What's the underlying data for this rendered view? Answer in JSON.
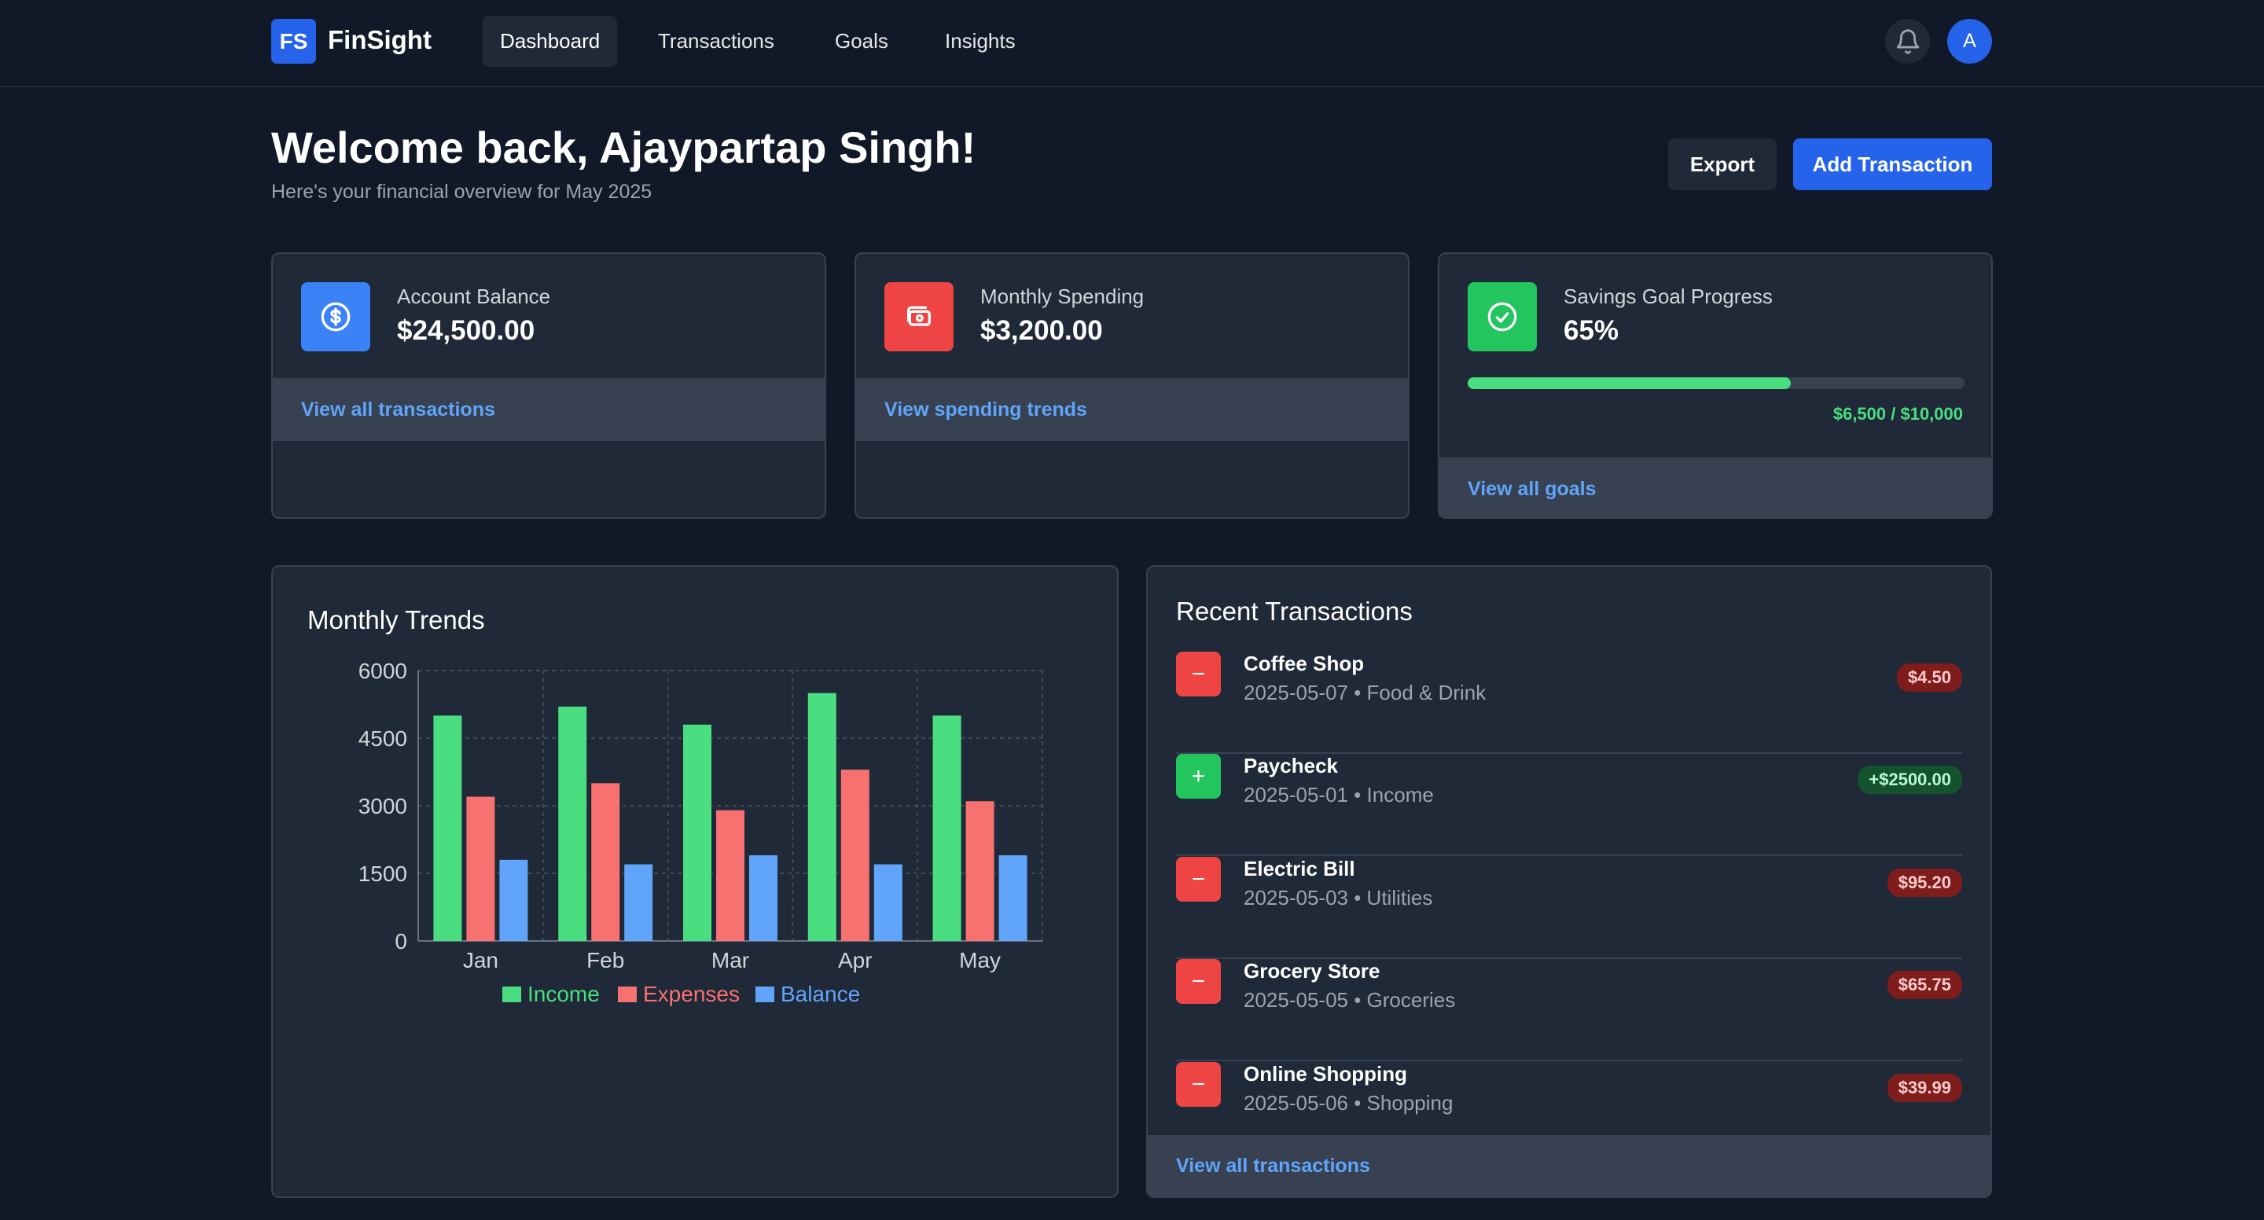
{
  "nav": {
    "logo": "FS",
    "brand": "FinSight",
    "links": [
      "Dashboard",
      "Transactions",
      "Goals",
      "Insights"
    ],
    "active": "Dashboard",
    "avatar_initial": "A"
  },
  "header": {
    "title": "Welcome back, Ajaypartap Singh!",
    "subtitle": "Here's your financial overview for May 2025",
    "export_label": "Export",
    "add_label": "Add Transaction"
  },
  "cards": {
    "balance": {
      "label": "Account Balance",
      "value": "$24,500.00",
      "link": "View all transactions",
      "icon": "dollar-circle-icon",
      "color": "#3b82f6"
    },
    "spending": {
      "label": "Monthly Spending",
      "value": "$3,200.00",
      "link": "View spending trends",
      "icon": "cash-icon",
      "color": "#ef4444"
    },
    "savings": {
      "label": "Savings Goal Progress",
      "value": "65%",
      "progress": 0.65,
      "progress_text": "$6,500 / $10,000",
      "link": "View all goals",
      "icon": "check-circle-icon",
      "color": "#22c55e"
    }
  },
  "trends": {
    "title": "Monthly Trends"
  },
  "chart_data": {
    "type": "bar",
    "categories": [
      "Jan",
      "Feb",
      "Mar",
      "Apr",
      "May"
    ],
    "series": [
      {
        "name": "Income",
        "values": [
          5000,
          5200,
          4800,
          5500,
          5000
        ],
        "color": "#4ade80"
      },
      {
        "name": "Expenses",
        "values": [
          3200,
          3500,
          2900,
          3800,
          3100
        ],
        "color": "#f87171"
      },
      {
        "name": "Balance",
        "values": [
          1800,
          1700,
          1900,
          1700,
          1900
        ],
        "color": "#60a5fa"
      }
    ],
    "yticks": [
      "0",
      "1500",
      "3000",
      "4500",
      "6000"
    ],
    "ylim": [
      0,
      6000
    ],
    "grid": true,
    "legend": "bottom"
  },
  "transactions": {
    "title": "Recent Transactions",
    "items": [
      {
        "name": "Coffee Shop",
        "meta": "2025-05-07 • Food & Drink",
        "amount": "$4.50",
        "type": "neg",
        "sign": "−"
      },
      {
        "name": "Paycheck",
        "meta": "2025-05-01 • Income",
        "amount": "+$2500.00",
        "type": "pos",
        "sign": "+"
      },
      {
        "name": "Electric Bill",
        "meta": "2025-05-03 • Utilities",
        "amount": "$95.20",
        "type": "neg",
        "sign": "−"
      },
      {
        "name": "Grocery Store",
        "meta": "2025-05-05 • Groceries",
        "amount": "$65.75",
        "type": "neg",
        "sign": "−"
      },
      {
        "name": "Online Shopping",
        "meta": "2025-05-06 • Shopping",
        "amount": "$39.99",
        "type": "neg",
        "sign": "−"
      }
    ],
    "footer_link": "View all transactions"
  }
}
